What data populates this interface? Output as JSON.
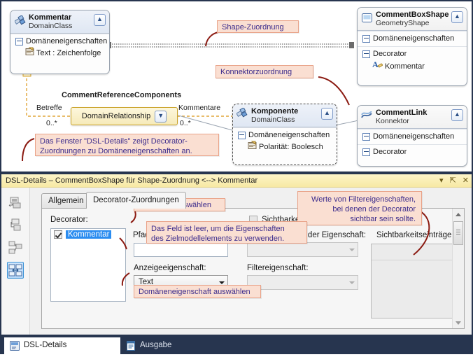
{
  "diagram": {
    "shapes": [
      {
        "id": "kommentar",
        "title": "Kommentar",
        "subtitle": "DomainClass",
        "icon": "domain-class-icon",
        "sections": [
          {
            "label": "Domäneneigenschaften",
            "items": [
              {
                "text": "Text : Zeichenfolge",
                "icon": "property-icon"
              }
            ]
          }
        ]
      },
      {
        "id": "commentboxshape",
        "title": "CommentBoxShape",
        "subtitle": "GeometryShape",
        "icon": "geometry-shape-icon",
        "sections": [
          {
            "label": "Domäneneigenschaften",
            "items": []
          },
          {
            "label": "Decorator",
            "items": [
              {
                "text": "Kommentar",
                "icon": "text-decorator-icon"
              }
            ]
          }
        ]
      },
      {
        "id": "komponente",
        "title": "Komponente",
        "subtitle": "DomainClass",
        "icon": "domain-class-icon",
        "sections": [
          {
            "label": "Domäneneigenschaften",
            "items": [
              {
                "text": "Polarität: Boolesch",
                "icon": "property-icon"
              }
            ]
          }
        ]
      },
      {
        "id": "commentlink",
        "title": "CommentLink",
        "subtitle": "Konnektor",
        "icon": "connector-icon",
        "sections": [
          {
            "label": "Domäneneigenschaften",
            "items": []
          },
          {
            "label": "Decorator",
            "items": []
          }
        ]
      }
    ],
    "relationship": {
      "name": "CommentReferenceComponents",
      "box_label": "DomainRelationship",
      "left_role": "Betreffe",
      "left_multiplicity": "0..*",
      "right_role": "Kommentare",
      "right_multiplicity": "0..*"
    },
    "callouts": [
      {
        "id": "shape-zuordnung",
        "text": "Shape-Zuordnung"
      },
      {
        "id": "konnektorzuordnung",
        "text": "Konnektorzuordnung"
      },
      {
        "id": "dsl-details-hinweis",
        "text": "Das Fenster \"DSL-Details\" zeigt Decorator-\nZuordnungen zu Domäneneigenschaften an."
      }
    ]
  },
  "toolwindow": {
    "title": "DSL-Details – CommentBoxShape für Shape-Zuordnung <--> Kommentar",
    "buttons": {
      "dropdown": "▾",
      "pin": "⇱",
      "close": "✕"
    },
    "toolbar_items": [
      {
        "id": "tb-1",
        "name": "relationship-tool-icon",
        "selected": false
      },
      {
        "id": "tb-2",
        "name": "element-merge-tool-icon",
        "selected": false
      },
      {
        "id": "tb-3",
        "name": "diagram-map-tool-icon",
        "selected": false
      },
      {
        "id": "tb-4",
        "name": "shape-map-tool-icon",
        "selected": true
      }
    ],
    "tabs": [
      {
        "id": "tab-allgemein",
        "label": "Allgemein",
        "active": false
      },
      {
        "id": "tab-decorator",
        "label": "Decorator-Zuordnungen",
        "active": true
      }
    ],
    "form": {
      "decorator_label": "Decorator:",
      "decorator_list": [
        {
          "label": "Kommentar",
          "checked": true,
          "selected": true
        }
      ],
      "visibility_filter_label": "Sichtbarkeitsfilter",
      "visibility_filter_checked": false,
      "display_path_label": "Pfad zum Anzeigen der Eigenschaft:",
      "display_path_value": "",
      "filter_path_label": "Pfad zum Filtern der Eigenschaft:",
      "filter_path_value": "",
      "display_property_label": "Anzeigeeigenschaft:",
      "display_property_value": "Text",
      "filter_property_label": "Filtereigenschaft:",
      "filter_property_value": "",
      "visibility_entries_label": "Sichtbarkeitseinträge"
    },
    "callouts": [
      {
        "id": "decorator-auswaehlen",
        "text": "Decorator auswählen"
      },
      {
        "id": "filter-werte",
        "text": "Werte von Filtereigenschaften,\nbei denen der Decorator\nsichtbar sein sollte."
      },
      {
        "id": "feld-leer",
        "text": "Das Feld ist leer, um die Eigenschaften\ndes Zielmodellelements zu verwenden."
      },
      {
        "id": "domaeneneigenschaft-auswaehlen",
        "text": "Domäneneigenschaft auswählen"
      }
    ]
  },
  "window_tabs": [
    {
      "id": "wtab-dsl-details",
      "label": "DSL-Details",
      "icon": "dsl-details-icon",
      "active": true
    },
    {
      "id": "wtab-ausgabe",
      "label": "Ausgabe",
      "icon": "output-icon",
      "active": false
    }
  ],
  "colors": {
    "callout_bg": "#fadfd2",
    "callout_border": "#e9a389",
    "callout_text": "#3b2b8c",
    "annotation_line": "#8b1a11",
    "titlebar_bg": "#f7e9a4",
    "selection_blue": "#2a8cf0",
    "window_chrome": "#27354f"
  }
}
